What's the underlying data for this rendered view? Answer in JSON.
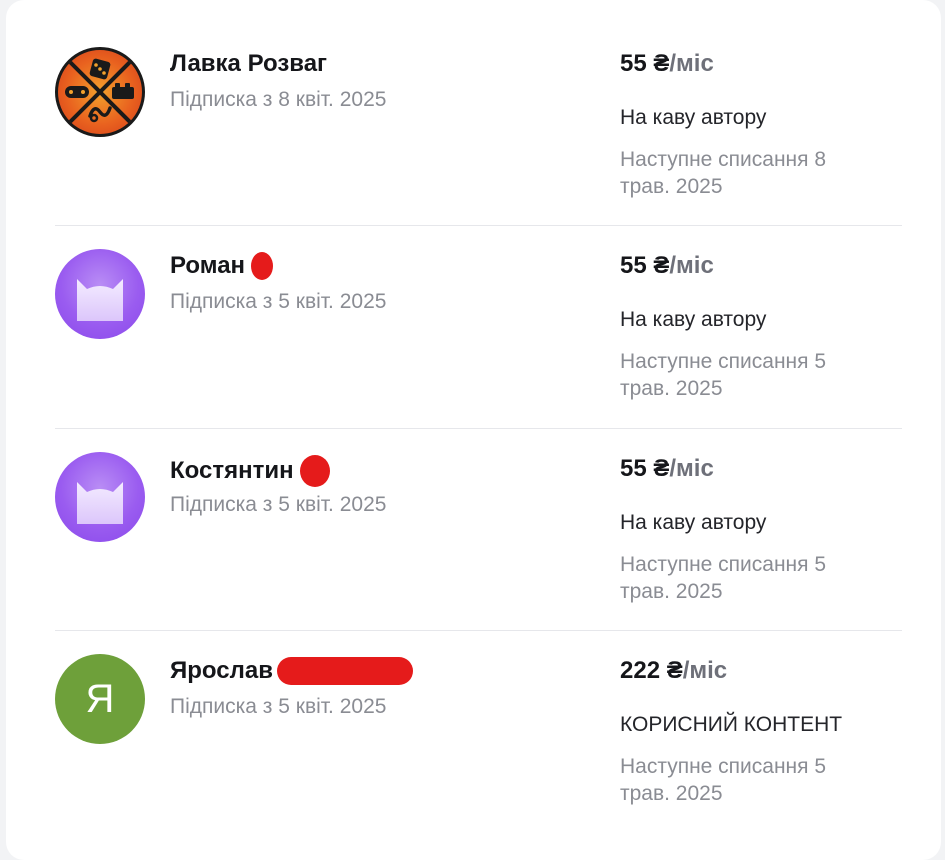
{
  "subscribers": [
    {
      "name": "Лавка Розваг",
      "since": "Підписка з 8 квіт. 2025",
      "price": "55 ₴",
      "period": "/міс",
      "tier": "На каву автору",
      "next": "Наступне списання 8 трав. 2025",
      "avatar": "logo-icon"
    },
    {
      "name": "Роман",
      "since": "Підписка з 5 квіт. 2025",
      "price": "55 ₴",
      "period": "/міс",
      "tier": "На каву автору",
      "next": "Наступне списання 5 трав. 2025",
      "avatar": "cat-icon"
    },
    {
      "name": "Костянтин",
      "since": "Підписка з 5 квіт. 2025",
      "price": "55 ₴",
      "period": "/міс",
      "tier": "На каву автору",
      "next": "Наступне списання 5 трав. 2025",
      "avatar": "cat-icon"
    },
    {
      "name": "Ярослав",
      "since": "Підписка з 5 квіт. 2025",
      "price": "222 ₴",
      "period": "/міс",
      "tier": "КОРИСНИЙ КОНТЕНТ",
      "next": "Наступне списання 5 трав. 2025",
      "avatar": "letter",
      "avatar_letter": "Я"
    }
  ],
  "colors": {
    "cat_avatar": "#9a5cf0",
    "letter_avatar": "#6ea03a",
    "redaction": "#e51b1b",
    "muted_text": "#8a8c93"
  }
}
